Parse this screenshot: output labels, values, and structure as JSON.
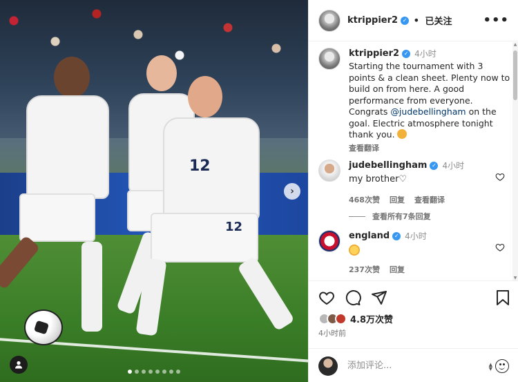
{
  "post": {
    "username": "ktrippier2",
    "follow_status": "已关注",
    "more_label": "•••",
    "caption": {
      "username": "ktrippier2",
      "time": "4小时",
      "text_before_mention": "Starting the tournament with 3 points & a clean sheet. Plenty now to build on from here. A good performance from everyone. Congrats ",
      "mention": "@judebellingham",
      "text_after_mention": " on the goal. Electric atmosphere tonight thank you.",
      "see_translation": "查看翻译"
    },
    "comments": [
      {
        "username": "judebellingham",
        "time": "4小时",
        "text": "my brother♡",
        "likes": "468次赞",
        "reply": "回复",
        "translate": "查看翻译"
      },
      {
        "username": "england",
        "time": "4小时",
        "likes": "237次赞",
        "reply": "回复"
      }
    ],
    "view_replies": "查看所有7条回复",
    "likes_count": "4.8万次赞",
    "post_time": "4小时前",
    "comment_placeholder": "添加评论...",
    "jersey_numbers": [
      "12",
      "12"
    ],
    "carousel": {
      "total": 8,
      "active": 0
    }
  },
  "colors": {
    "verified": "#3897f0",
    "mention": "#00376b",
    "secondary_text": "#737373"
  },
  "icons": [
    "more-icon",
    "verified-icon",
    "heart-icon",
    "comment-icon",
    "share-icon",
    "bookmark-icon",
    "emoji-icon",
    "next-arrow-icon",
    "user-tag-icon"
  ]
}
